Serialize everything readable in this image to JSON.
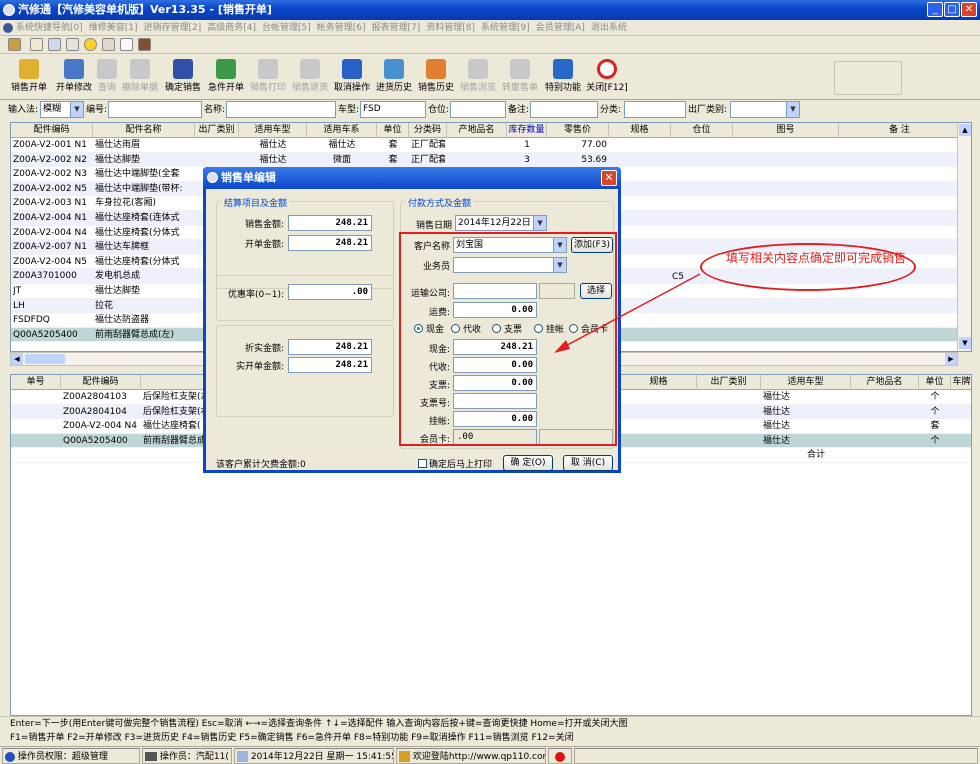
{
  "window": {
    "title": "汽修通【汽修美容单机版】Ver13.35 - [销售开单]"
  },
  "menu": [
    "系统快捷导航[0]",
    "维修美容[1]",
    "进销存管理[2]",
    "高级商务[4]",
    "台帐管理[5]",
    "帐务管理[6]",
    "报表管理[7]",
    "资料管理[8]",
    "系统管理[9]",
    "会员管理[A]",
    "退出系统"
  ],
  "toolbar": [
    {
      "label": "销售开单",
      "icon": "sales-order-icon",
      "enabled": true
    },
    {
      "label": "开单修改",
      "icon": "edit-order-icon",
      "enabled": true
    },
    {
      "label": "查询",
      "icon": "query-icon",
      "enabled": false
    },
    {
      "label": "撤除单据",
      "icon": "delete-icon",
      "enabled": false
    },
    {
      "label": "确定销售",
      "icon": "save-icon",
      "enabled": true
    },
    {
      "label": "急件开单",
      "icon": "urgent-icon",
      "enabled": true
    },
    {
      "label": "销售打印",
      "icon": "print-icon",
      "enabled": false
    },
    {
      "label": "销售退货",
      "icon": "return-icon",
      "enabled": false
    },
    {
      "label": "取消操作",
      "icon": "undo-icon",
      "enabled": true
    },
    {
      "label": "进货历史",
      "icon": "history-icon",
      "enabled": true
    },
    {
      "label": "销售历史",
      "icon": "home-icon",
      "enabled": true
    },
    {
      "label": "销售浏览",
      "icon": "browse-icon",
      "enabled": false
    },
    {
      "label": "转废售单",
      "icon": "void-icon",
      "enabled": false
    },
    {
      "label": "特别功能",
      "icon": "special-icon",
      "enabled": true
    },
    {
      "label": "关闭[F12]",
      "icon": "close-icon",
      "enabled": true
    }
  ],
  "filter": {
    "input_method_label": "输入法:",
    "input_method_value": "模糊",
    "code_label": "编号:",
    "name_label": "名称:",
    "model_label": "车型:",
    "model_value": "FSD",
    "position_label": "仓位:",
    "remark_label": "备注:",
    "category_label": "分类:",
    "factory_label": "出厂类别:"
  },
  "grid1": {
    "headers": [
      "配件编码",
      "配件名称",
      "出厂类别",
      "适用车型",
      "适用车系",
      "单位",
      "分类码",
      "产地品名",
      "库存数量",
      "零售价",
      "规格",
      "仓位",
      "图号",
      "备 注"
    ],
    "rows": [
      [
        "Z00A-V2-001 N1",
        "福仕达雨眉",
        "",
        "福仕达",
        "福仕达",
        "套",
        "正厂配套",
        "",
        "1",
        "77.00"
      ],
      [
        "Z00A-V2-002 N2",
        "福仕达脚垫",
        "",
        "福仕达",
        "微面",
        "套",
        "正厂配套",
        "",
        "3",
        "53.69"
      ],
      [
        "Z00A-V2-002 N3",
        "福仕达中端脚垫(全套",
        "",
        "",
        "",
        "",
        "",
        "",
        "",
        ""
      ],
      [
        "Z00A-V2-002 N5",
        "福仕达中端脚垫(带杯:",
        "",
        "",
        "",
        "",
        "",
        "",
        "",
        ""
      ],
      [
        "Z00A-V2-003 N1",
        "车身拉花(客厢)",
        "",
        "",
        "",
        "",
        "",
        "",
        "",
        ""
      ],
      [
        "Z00A-V2-004 N1",
        "福仕达座椅套(连体式",
        "",
        "",
        "",
        "",
        "",
        "",
        "",
        ""
      ],
      [
        "Z00A-V2-004 N4",
        "福仕达座椅套(分体式",
        "",
        "",
        "",
        "",
        "",
        "",
        "",
        ""
      ],
      [
        "Z00A-V2-007 N1",
        "福仕达车牌框",
        "",
        "",
        "",
        "",
        "",
        "",
        "",
        ""
      ],
      [
        "Z00A-V2-004 N5",
        "福仕达座椅套(分体式",
        "",
        "",
        "",
        "",
        "",
        "",
        "",
        ""
      ],
      [
        "Z00A3701000",
        "发电机总成",
        "",
        "",
        "",
        "",
        "",
        "",
        "",
        ""
      ],
      [
        "JT",
        "福仕达脚垫",
        "",
        "",
        "",
        "",
        "",
        "",
        "",
        ""
      ],
      [
        "LH",
        "拉花",
        "",
        "",
        "",
        "",
        "",
        "",
        "",
        ""
      ],
      [
        "FSDFDQ",
        "福仕达防盗器",
        "",
        "",
        "",
        "",
        "",
        "",
        "",
        ""
      ],
      [
        "Q00A5205400",
        "前雨刮器臂总成(左)",
        "",
        "",
        "",
        "",
        "",
        "",
        "",
        ""
      ]
    ]
  },
  "grid2": {
    "headers": [
      "单号",
      "配件编码",
      "配件名称",
      "规格",
      "出厂类别",
      "适用车型",
      "产地品名",
      "单位",
      "车牌"
    ],
    "rows": [
      [
        "",
        "Z00A2804103",
        "后保险杠支架(左",
        "",
        "",
        "福仕达",
        "",
        "个",
        ""
      ],
      [
        "",
        "Z00A2804104",
        "后保险杠支架(右",
        "",
        "",
        "福仕达",
        "",
        "个",
        ""
      ],
      [
        "",
        "Z00A-V2-004 N4",
        "福仕达座椅套(",
        "",
        "",
        "福仕达",
        "",
        "套",
        ""
      ],
      [
        "",
        "Q00A5205400",
        "前雨刮器臂总成",
        "",
        "",
        "福仕达",
        "",
        "个",
        ""
      ]
    ],
    "total_label": "合计"
  },
  "dialog": {
    "title": "销售单编辑",
    "settle_group": "结算项目及金额",
    "sales_amount_label": "销售金额:",
    "sales_amount": "248.21",
    "order_amount_label": "开单金额:",
    "order_amount": "248.21",
    "discount_label": "优惠率(0~1):",
    "discount": ".00",
    "actual_amount_label": "折实金额:",
    "actual_amount": "248.21",
    "actual_order_label": "实开单金额:",
    "actual_order": "248.21",
    "debt_label": "该客户累计欠费金额:0",
    "pay_group": "付款方式及金额",
    "date_label": "销售日期",
    "date_value": "2014年12月22日",
    "customer_label": "客户名称",
    "customer_value": "刘宝国",
    "add_button": "添加(F3)",
    "salesman_label": "业务员",
    "salesman_value": "",
    "transport_label": "运输公司:",
    "transport_value": "",
    "select_button": "选择",
    "freight_label": "运费:",
    "freight": "0.00",
    "pay_methods": [
      "现金",
      "代收",
      "支票",
      "挂帐",
      "会员卡"
    ],
    "pay_selected": 0,
    "cash_label": "现金:",
    "cash": "248.21",
    "collect_label": "代收:",
    "collect": "0.00",
    "check_label": "支票:",
    "check": "0.00",
    "check_no_label": "支票号:",
    "check_no": "",
    "credit_label": "挂帐:",
    "credit": "0.00",
    "member_label": "会员卡:",
    "member": ".00",
    "print_checkbox": "确定后马上打印",
    "print_checked": false,
    "ok_button": "确 定(O)",
    "cancel_button": "取 消(C)"
  },
  "annotation": {
    "text": "填写相关内容点确定即可完成销售",
    "marker": "C5"
  },
  "hints": {
    "line1": "Enter=下一步(用Enter键可做完整个销售流程) Esc=取消 ←→=选择查询条件 ↑↓=选择配件 输入查询内容后按+键=查询更快捷 Home=打开或关闭大图",
    "line2": "F1=销售开单 F2=开单修改 F3=进货历史 F4=销售历史 F5=确定销售 F6=急件开单 F8=特别功能 F9=取消操作 F11=销售浏览 F12=关闭"
  },
  "status": {
    "permission": "操作员权限：超级管理",
    "operator": "操作员：汽配11(",
    "datetime": "2014年12月22日 星期一 15:41:55",
    "welcome": "欢迎登陆http://www.qp110.com"
  }
}
